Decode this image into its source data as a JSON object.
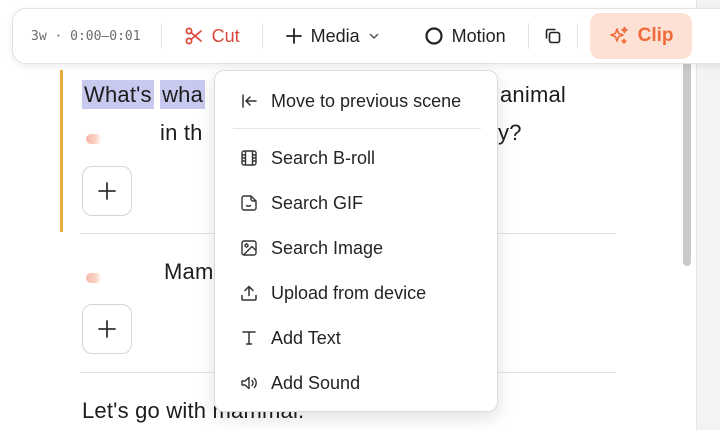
{
  "toolbar": {
    "time": "3w · 0:00–0:01",
    "cut_label": "Cut",
    "media_label": "Media",
    "motion_label": "Motion",
    "clip_label": "Clip",
    "colors": {
      "cut": "#d9483b",
      "clip_text": "#ef6b3b",
      "clip_bg": "#fde1d4"
    }
  },
  "media_menu": {
    "items": [
      {
        "label": "Move to previous scene",
        "icon": "arrow-left-to-line-icon"
      },
      {
        "label": "Search B-roll",
        "icon": "film-icon"
      },
      {
        "label": "Search GIF",
        "icon": "sticker-icon"
      },
      {
        "label": "Search Image",
        "icon": "image-icon"
      },
      {
        "label": "Upload from device",
        "icon": "upload-icon"
      },
      {
        "label": "Add Text",
        "icon": "text-icon"
      },
      {
        "label": "Add Sound",
        "icon": "speaker-icon"
      }
    ]
  },
  "scenes": [
    {
      "line1_hl1": "What's",
      "line1_hl2": "wha",
      "line1_tail": "animal",
      "line2_head": "in th",
      "line2_tail": "y?"
    },
    {
      "line1": "Mam"
    },
    {
      "line1": "Let's go with mammal."
    }
  ],
  "accent_color": "#e9a83a"
}
